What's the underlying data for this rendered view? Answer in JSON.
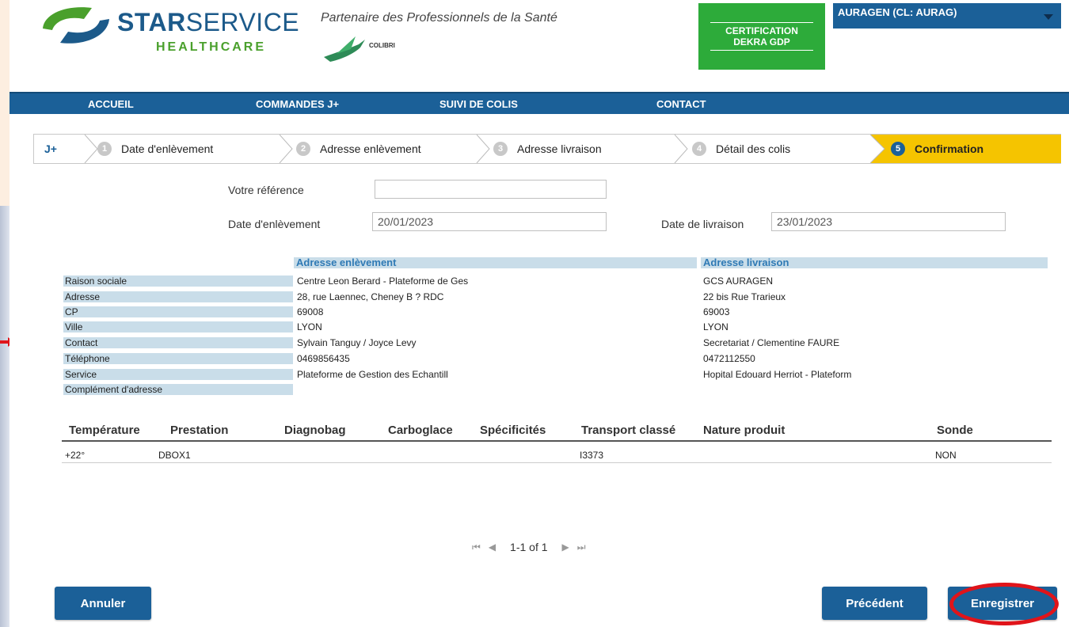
{
  "header": {
    "brand_star": "STAR",
    "brand_service": "SERVICE",
    "brand_healthcare": "HEALTHCARE",
    "tagline": "Partenaire des Professionnels de la Santé",
    "colibri": "COLIBRI",
    "cert_line1": "CERTIFICATION",
    "cert_line2": "DEKRA GDP",
    "client": "AURAGEN (CL: AURAG)"
  },
  "nav": {
    "accueil": "ACCUEIL",
    "commandes": "COMMANDES J+",
    "suivi": "SUIVI DE COLIS",
    "contact": "CONTACT"
  },
  "steps": {
    "jplus": "J+",
    "s1_num": "1",
    "s1": "Date d'enlèvement",
    "s2_num": "2",
    "s2": "Adresse enlèvement",
    "s3_num": "3",
    "s3": "Adresse livraison",
    "s4_num": "4",
    "s4": "Détail des colis",
    "s5_num": "5",
    "s5": "Confirmation"
  },
  "form": {
    "ref_label": "Votre référence",
    "ref_value": "",
    "pickup_label": "Date d'enlèvement",
    "pickup_value": "20/01/2023",
    "delivery_label": "Date de livraison",
    "delivery_value": "23/01/2023"
  },
  "address": {
    "pickup_head": "Adresse enlèvement",
    "delivery_head": "Adresse livraison",
    "labels": [
      "Raison sociale",
      "Adresse",
      "CP",
      "Ville",
      "Contact",
      "Téléphone",
      "Service",
      "Complément d'adresse"
    ],
    "pickup": [
      "Centre Leon Berard - Plateforme de Ges",
      "28, rue Laennec, Cheney B ? RDC",
      "69008",
      "LYON",
      "Sylvain Tanguy / Joyce Levy",
      "0469856435",
      "Plateforme de Gestion des Echantill",
      ""
    ],
    "delivery": [
      "GCS AURAGEN",
      "22 bis Rue Trarieux",
      "69003",
      "LYON",
      "Secretariat / Clementine FAURE",
      "0472112550",
      "Hopital Edouard Herriot - Plateform",
      ""
    ]
  },
  "table": {
    "headers": [
      "Température",
      "Prestation",
      "Diagnobag",
      "Carboglace",
      "Spécificités",
      "Transport classé",
      "Nature produit",
      "Sonde"
    ],
    "row": [
      "+22°",
      "DBOX1",
      "",
      "",
      "",
      "I3373",
      "",
      "NON"
    ]
  },
  "pager": {
    "text": "1-1 of 1"
  },
  "buttons": {
    "cancel": "Annuler",
    "previous": "Précédent",
    "save": "Enregistrer"
  },
  "colors": {
    "primary": "#1b6098",
    "accent": "#f5c400",
    "cert": "#2dab3a",
    "highlight": "#e0141a"
  }
}
